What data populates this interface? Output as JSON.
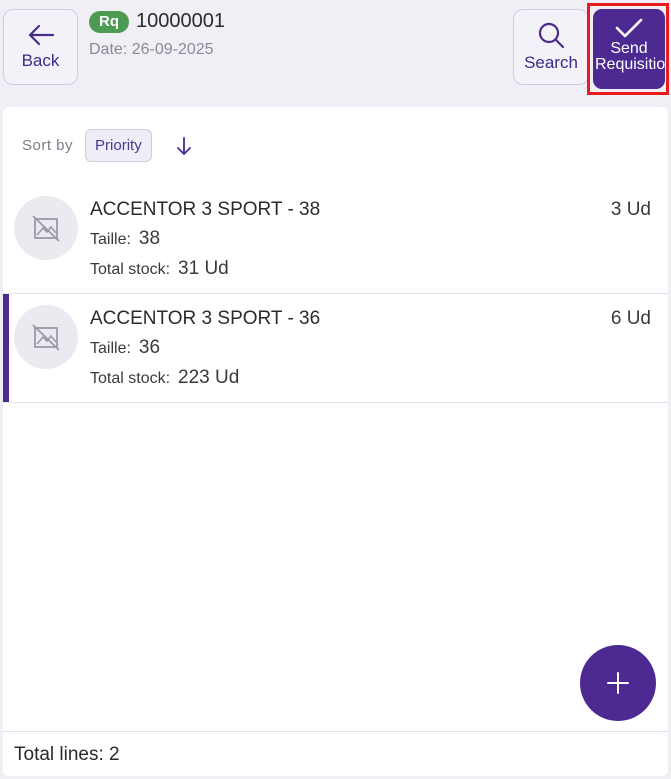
{
  "header": {
    "back_label": "Back",
    "badge": "Rq",
    "doc_number": "10000001",
    "date": "Date: 26-09-2025",
    "search_label": "Search",
    "send_label": "Send Requisition"
  },
  "sort": {
    "label": "Sort by",
    "value": "Priority",
    "direction": "descending"
  },
  "items": [
    {
      "name": "ACCENTOR 3 SPORT - 38",
      "qty": "3 Ud",
      "size_label": "Taille:",
      "size": "38",
      "stock_label": "Total stock:",
      "stock": "31 Ud",
      "active": false
    },
    {
      "name": "ACCENTOR 3 SPORT - 36",
      "qty": "6 Ud",
      "size_label": "Taille:",
      "size": "36",
      "stock_label": "Total stock:",
      "stock": "223 Ud",
      "active": true
    }
  ],
  "footer": {
    "total_lines": "Total lines: 2"
  },
  "icons": {
    "back": "arrow-left-icon",
    "search": "search-icon",
    "send": "check-icon",
    "sort": "arrow-down-icon",
    "thumb": "no-image-icon",
    "fab": "plus-icon"
  },
  "colors": {
    "accent": "#4c2a91",
    "badge": "#4d9a52",
    "highlight": "#e81c1c"
  }
}
